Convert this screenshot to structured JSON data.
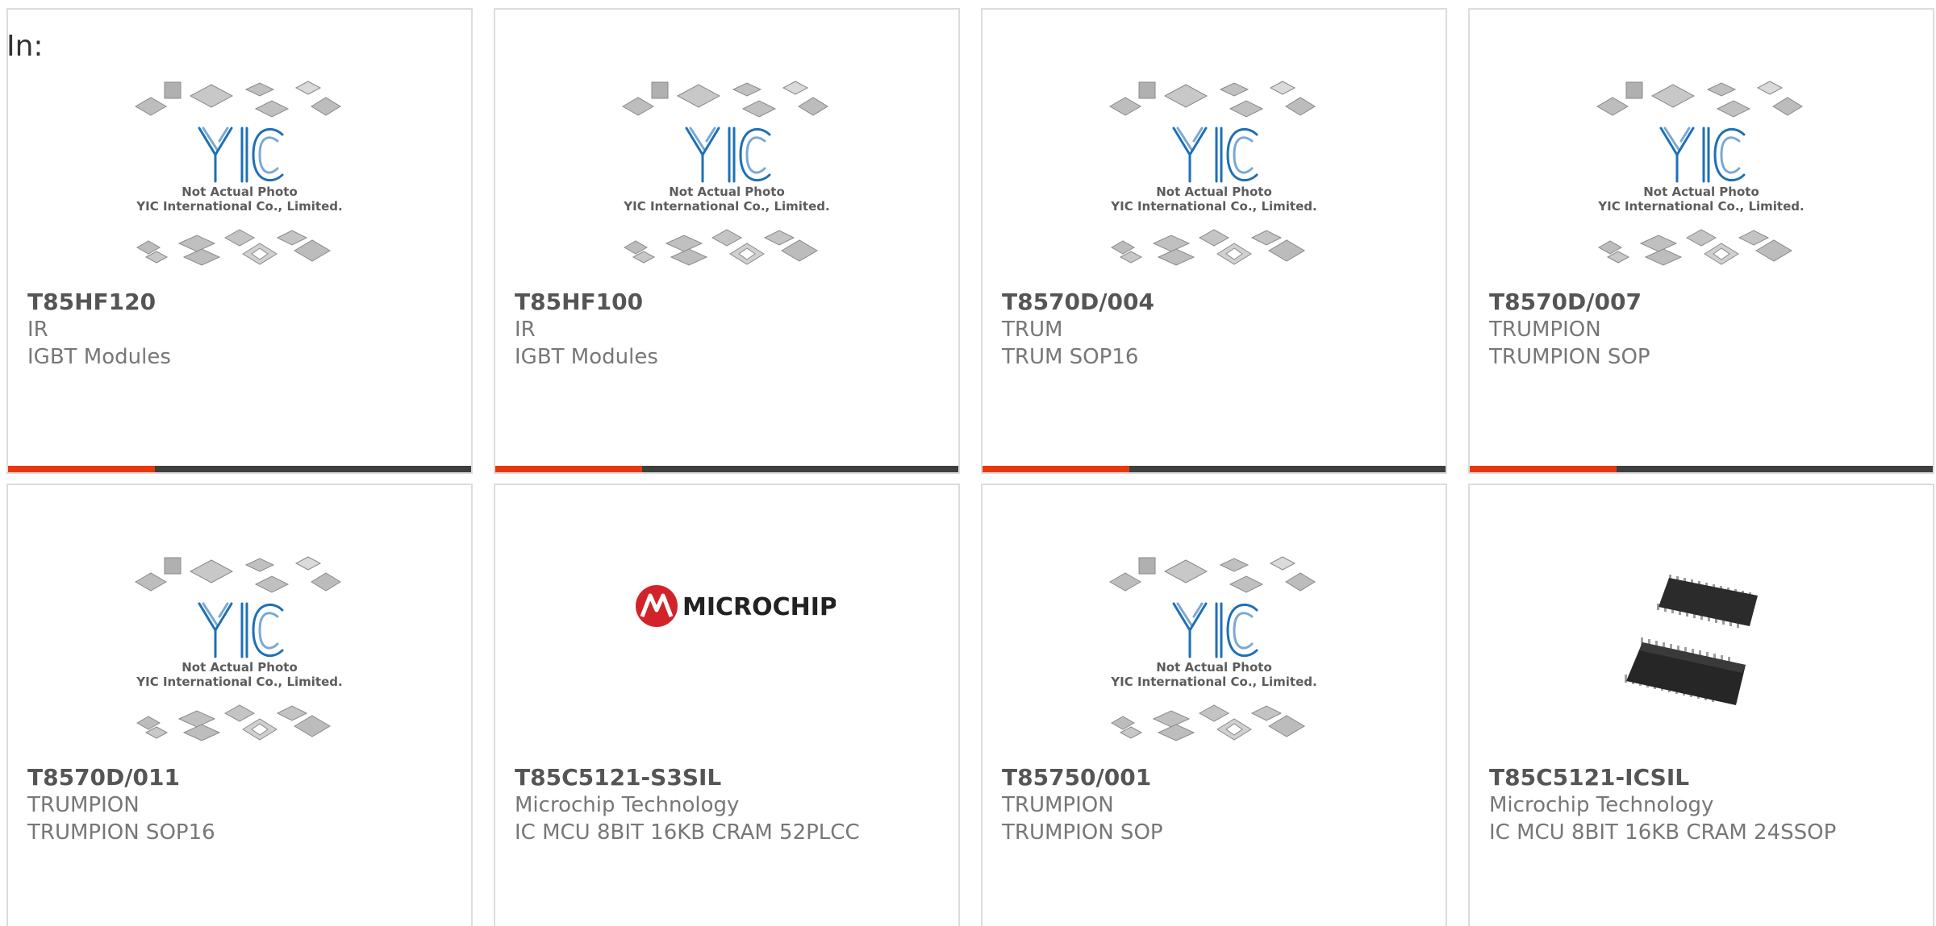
{
  "label": "In:",
  "colors": {
    "accent": "#e8390e",
    "bar": "#3f3f3f",
    "yic_blue": "#1e6fb5",
    "microchip_red": "#d2232a"
  },
  "placeholder": {
    "line1": "Not Actual Photo",
    "line2": "YIC International Co., Limited."
  },
  "microchip_logo": {
    "text": "MICROCHIP"
  },
  "products": [
    {
      "part": "T85HF120",
      "brand": "IR",
      "desc": "IGBT Modules",
      "image": "yic-placeholder",
      "bar": true
    },
    {
      "part": "T85HF100",
      "brand": "IR",
      "desc": "IGBT Modules",
      "image": "yic-placeholder",
      "bar": true
    },
    {
      "part": "T8570D/004",
      "brand": "TRUM",
      "desc": "TRUM SOP16",
      "image": "yic-placeholder",
      "bar": true
    },
    {
      "part": "T8570D/007",
      "brand": "TRUMPION",
      "desc": "TRUMPION SOP",
      "image": "yic-placeholder",
      "bar": true
    },
    {
      "part": "T8570D/011",
      "brand": "TRUMPION",
      "desc": "TRUMPION SOP16",
      "image": "yic-placeholder",
      "bar": false
    },
    {
      "part": "T85C5121-S3SIL",
      "brand": "Microchip Technology",
      "desc": "IC MCU 8BIT 16KB CRAM 52PLCC",
      "image": "microchip-logo",
      "bar": false
    },
    {
      "part": "T85750/001",
      "brand": "TRUMPION",
      "desc": "TRUMPION SOP",
      "image": "yic-placeholder",
      "bar": false
    },
    {
      "part": "T85C5121-ICSIL",
      "brand": "Microchip Technology",
      "desc": "IC MCU 8BIT 16KB CRAM 24SSOP",
      "image": "ssop-chip",
      "bar": false
    }
  ]
}
